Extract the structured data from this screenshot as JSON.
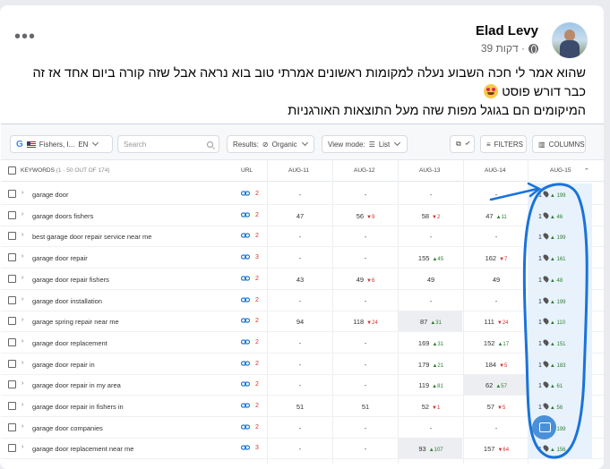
{
  "post": {
    "author": "Elad Levy",
    "time": "39 דקות ·",
    "text_line1": "שהוא אמר לי חכה השבוע נעלה למקומות ראשונים אמרתי טוב בוא נראה אבל שזה קורה ביום אחד אז זה כבר דורש פוסט",
    "text_line2": "המיקומים הם בגוגל מפות שזה מעל התוצאות האורגניות",
    "menu_icon": "more-dots-icon",
    "privacy_icon": "globe-icon"
  },
  "toolbar": {
    "location": "Fishers, I...",
    "language": "EN",
    "search_placeholder": "Search",
    "results_label": "Results:",
    "results_value": "Organic",
    "view_mode_label": "View mode:",
    "view_mode_value": "List",
    "filters_label": "FILTERS",
    "columns_label": "COLUMNS"
  },
  "table": {
    "headers": {
      "keywords": "KEYWORDS",
      "keywords_count": "(1 - 50 OUT OF 174)",
      "url": "URL",
      "dates": [
        "AUG-11",
        "AUG-12",
        "AUG-13",
        "AUG-14",
        "AUG-15"
      ]
    },
    "rows": [
      {
        "kw": "garage door",
        "links": "2",
        "d11": "-",
        "d12": "-",
        "d13": "-",
        "d13c": "",
        "d14": "-",
        "d14c": "",
        "pos": "1",
        "chg": "▲ 199"
      },
      {
        "kw": "garage doors fishers",
        "links": "2",
        "d11": "47",
        "d12": "56",
        "d12c": "▼9",
        "d13": "58",
        "d13c": "▼2",
        "d14": "47",
        "d14c": "▲11",
        "pos": "1",
        "chg": "▲ 46"
      },
      {
        "kw": "best garage door repair service near me",
        "links": "2",
        "d11": "-",
        "d12": "-",
        "d13": "-",
        "d13c": "",
        "d14": "-",
        "d14c": "",
        "pos": "1",
        "chg": "▲ 199"
      },
      {
        "kw": "garage door repair",
        "links": "3",
        "d11": "-",
        "d12": "-",
        "d13": "155",
        "d13c": "▲45",
        "d14": "162",
        "d14c": "▼7",
        "pos": "1",
        "chg": "▲ 161"
      },
      {
        "kw": "garage door repair fishers",
        "links": "2",
        "d11": "43",
        "d12": "49",
        "d12c": "▼6",
        "d13": "49",
        "d13c": "",
        "d14": "49",
        "d14c": "",
        "pos": "1",
        "chg": "▲ 48"
      },
      {
        "kw": "garage door installation",
        "links": "2",
        "d11": "-",
        "d12": "-",
        "d13": "-",
        "d13c": "",
        "d14": "-",
        "d14c": "",
        "pos": "1",
        "chg": "▲ 199"
      },
      {
        "kw": "garage spring repair near me",
        "links": "2",
        "d11": "94",
        "d12": "118",
        "d12c": "▼24",
        "d13": "87",
        "d13c": "▲31",
        "d14": "111",
        "d14c": "▼24",
        "pos": "1",
        "chg": "▲ 110"
      },
      {
        "kw": "garage door replacement",
        "links": "2",
        "d11": "-",
        "d12": "-",
        "d13": "169",
        "d13c": "▲31",
        "d14": "152",
        "d14c": "▲17",
        "pos": "1",
        "chg": "▲ 151"
      },
      {
        "kw": "garage door repair in",
        "links": "2",
        "d11": "-",
        "d12": "-",
        "d13": "179",
        "d13c": "▲21",
        "d14": "184",
        "d14c": "▼5",
        "pos": "1",
        "chg": "▲ 183"
      },
      {
        "kw": "garage door repair in my area",
        "links": "2",
        "d11": "-",
        "d12": "-",
        "d13": "119",
        "d13c": "▲81",
        "d14": "62",
        "d14c": "▲57",
        "pos": "1",
        "chg": "▲ 61"
      },
      {
        "kw": "garage door repair in fishers in",
        "links": "2",
        "d11": "51",
        "d12": "51",
        "d12c": "",
        "d13": "52",
        "d13c": "▼1",
        "d14": "57",
        "d14c": "▼5",
        "pos": "1",
        "chg": "▲ 56"
      },
      {
        "kw": "garage door companies",
        "links": "2",
        "d11": "-",
        "d12": "-",
        "d13": "-",
        "d13c": "",
        "d14": "-",
        "d14c": "",
        "pos": "1",
        "chg": "▲ 199"
      },
      {
        "kw": "garage door replacement near me",
        "links": "3",
        "d11": "-",
        "d12": "-",
        "d13": "93",
        "d13c": "▲107",
        "d14": "157",
        "d14c": "▼64",
        "pos": "1",
        "chg": "▲ 156"
      }
    ]
  },
  "colors": {
    "accent_blue": "#1f7ad8",
    "up_green": "#2e7d32",
    "down_red": "#d32f2f",
    "annotation": "#1a73d9"
  }
}
